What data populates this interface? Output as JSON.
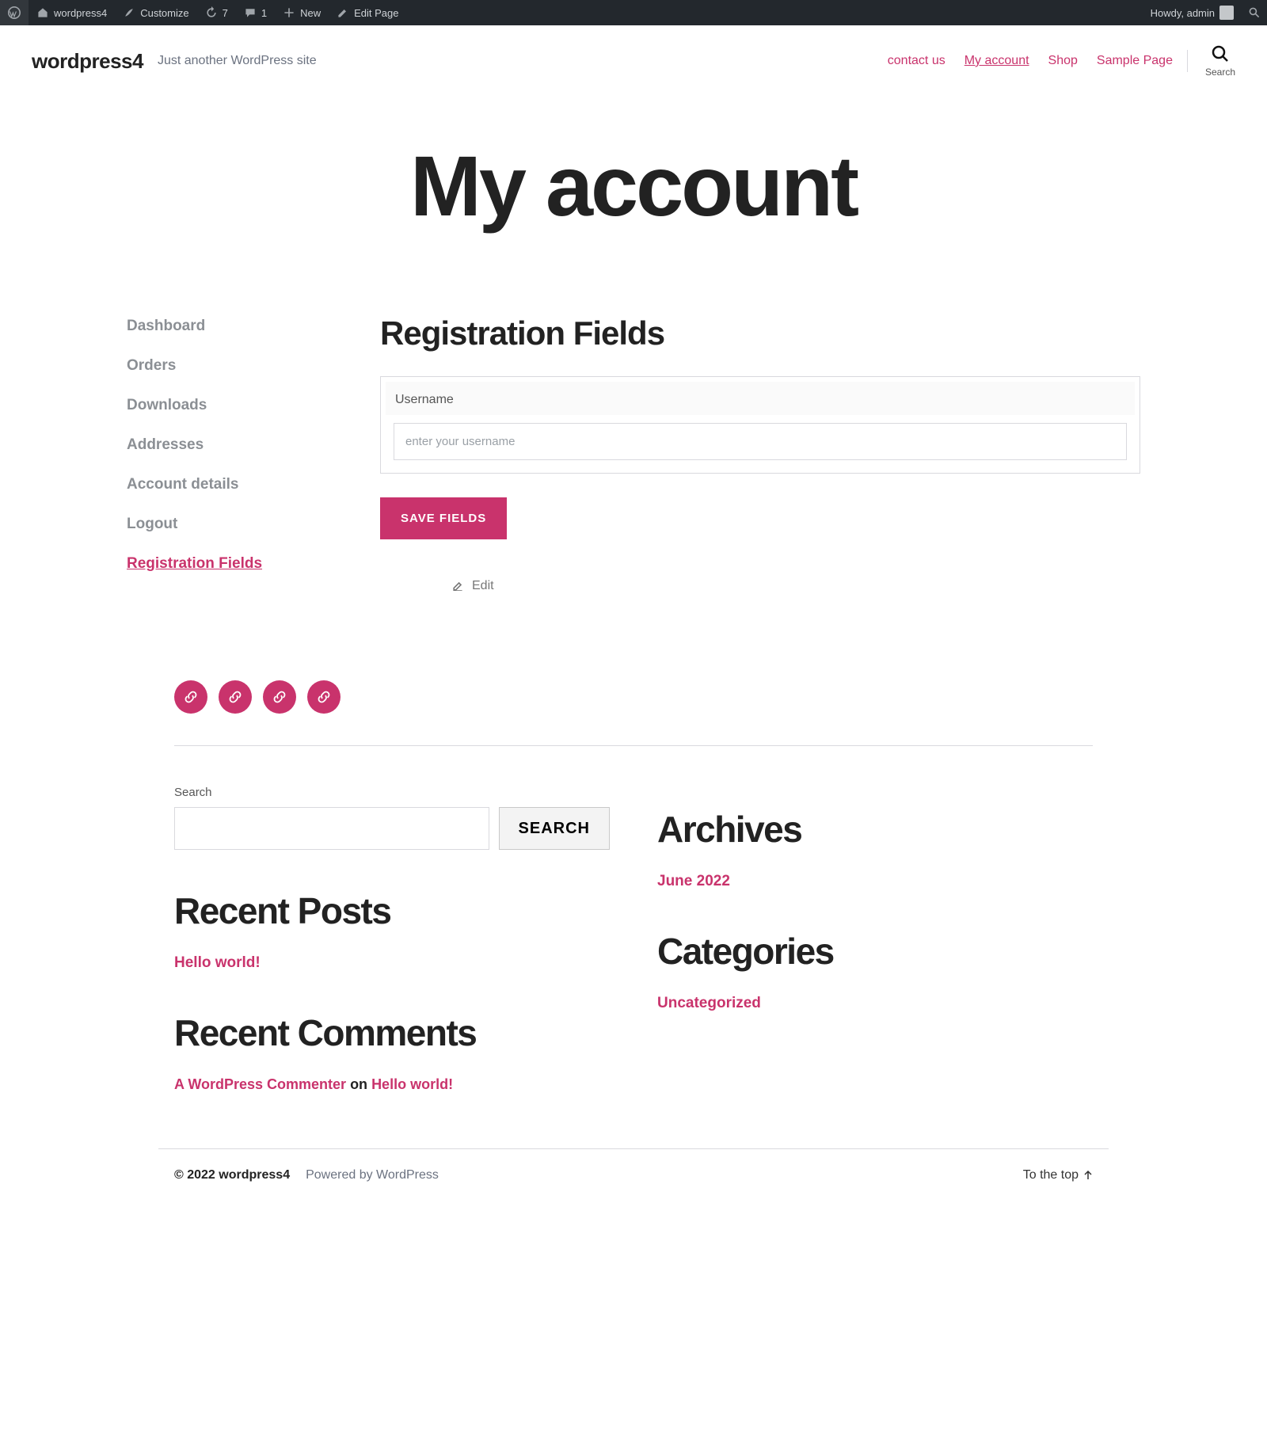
{
  "adminbar": {
    "site": "wordpress4",
    "customize": "Customize",
    "updates": "7",
    "comments": "1",
    "new": "New",
    "edit": "Edit Page",
    "howdy": "Howdy, admin"
  },
  "header": {
    "site_title": "wordpress4",
    "tagline": "Just another WordPress site",
    "nav": {
      "contact": "contact us",
      "account": "My account",
      "shop": "Shop",
      "sample": "Sample Page"
    },
    "search_label": "Search"
  },
  "page": {
    "title": "My account"
  },
  "account_nav": {
    "dashboard": "Dashboard",
    "orders": "Orders",
    "downloads": "Downloads",
    "addresses": "Addresses",
    "details": "Account details",
    "logout": "Logout",
    "reg": "Registration Fields"
  },
  "reg": {
    "heading": "Registration Fields",
    "field_label": "Username",
    "placeholder": "enter your username",
    "save": "SAVE FIELDS",
    "edit": "Edit"
  },
  "footer_search": {
    "label": "Search",
    "button": "SEARCH"
  },
  "recent_posts": {
    "heading": "Recent Posts",
    "item": "Hello world!"
  },
  "recent_comments": {
    "heading": "Recent Comments",
    "author": "A WordPress Commenter",
    "on": " on ",
    "post": "Hello world!"
  },
  "archives": {
    "heading": "Archives",
    "item": "June 2022"
  },
  "categories": {
    "heading": "Categories",
    "item": "Uncategorized"
  },
  "footer": {
    "copy": "© 2022 wordpress4",
    "powered": "Powered by WordPress",
    "top": "To the top"
  }
}
